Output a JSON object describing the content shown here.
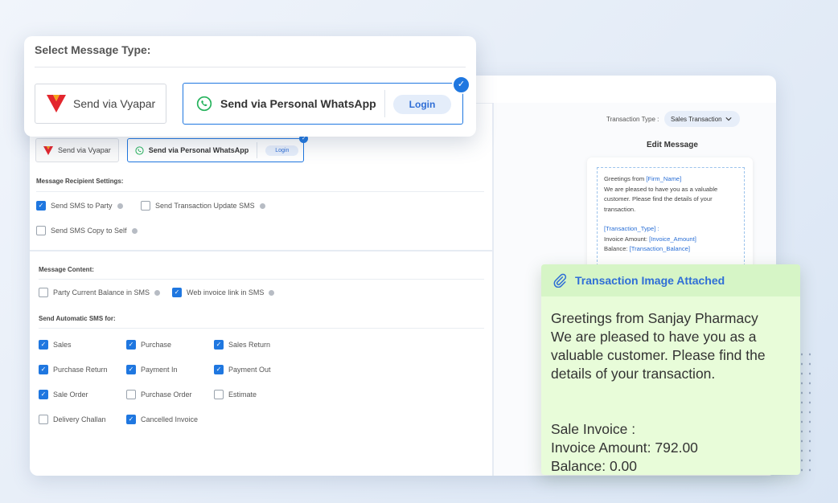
{
  "popup": {
    "title": "Select Message Type:",
    "vyapar_label": "Send via Vyapar",
    "whatsapp_label": "Send via Personal WhatsApp",
    "login_label": "Login"
  },
  "settings": {
    "tabs": {
      "vyapar": "Send via Vyapar",
      "whatsapp": "Send via Personal WhatsApp",
      "login": "Login"
    },
    "recipient": {
      "title": "Message Recipient Settings:",
      "options": [
        {
          "label": "Send SMS to Party",
          "checked": true,
          "info": true
        },
        {
          "label": "Send Transaction Update SMS",
          "checked": false,
          "info": true
        },
        {
          "label": "Send SMS Copy to Self",
          "checked": false,
          "info": true
        }
      ]
    },
    "content": {
      "title": "Message Content:",
      "options": [
        {
          "label": "Party Current Balance in SMS",
          "checked": false,
          "info": true
        },
        {
          "label": "Web invoice link in SMS",
          "checked": true,
          "info": true
        }
      ]
    },
    "automatic": {
      "title": "Send Automatic SMS for:",
      "options": [
        {
          "label": "Sales",
          "checked": true
        },
        {
          "label": "Purchase",
          "checked": true
        },
        {
          "label": "Sales Return",
          "checked": true
        },
        {
          "label": "Purchase Return",
          "checked": true
        },
        {
          "label": "Payment In",
          "checked": true
        },
        {
          "label": "Payment Out",
          "checked": true
        },
        {
          "label": "Sale Order",
          "checked": true
        },
        {
          "label": "Purchase Order",
          "checked": false
        },
        {
          "label": "Estimate",
          "checked": false
        },
        {
          "label": "Delivery Challan",
          "checked": false
        },
        {
          "label": "Cancelled Invoice",
          "checked": true
        }
      ]
    }
  },
  "editor": {
    "transaction_type_label": "Transaction Type :",
    "transaction_type_value": "Sales Transaction",
    "edit_title": "Edit Message",
    "template": {
      "l1": "Greetings from ",
      "firm": "[Firm_Name]",
      "l2": "We are pleased to have you as a valuable",
      "l3": "customer. Please find the details of your",
      "l4": "transaction.",
      "type": "[Transaction_Type]",
      "type_suffix": " :",
      "amount_label": "Invoice Amount: ",
      "amount": "[Invoice_Amount]",
      "balance_label": "Balance: ",
      "balance": "[Transaction_Balance]"
    }
  },
  "preview": {
    "attached_label": "Transaction Image Attached",
    "greeting": "Greetings from Sanjay Pharmacy",
    "body_1": "We are pleased to have you as a",
    "body_2": "valuable customer. Please find the",
    "body_3": "details of your transaction.",
    "invoice_title": "Sale Invoice :",
    "invoice_amount": "Invoice Amount: 792.00",
    "balance": "Balance: 0.00"
  },
  "colors": {
    "accent": "#1f77e0",
    "preview_bg": "#e8fcd9",
    "whatsapp": "#25b35c",
    "vyapar_red": "#e3262d"
  }
}
